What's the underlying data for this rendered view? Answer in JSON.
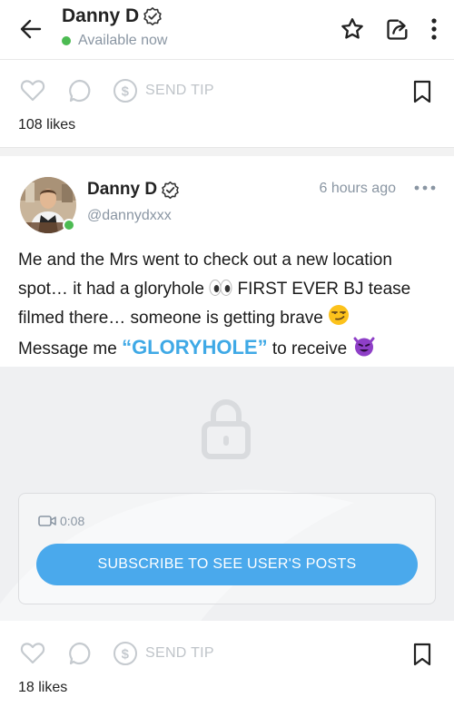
{
  "header": {
    "name": "Danny D",
    "status": "Available now"
  },
  "top_post": {
    "send_tip": "SEND TIP",
    "likes": "108 likes"
  },
  "post": {
    "author": "Danny D",
    "handle": "@dannydxxx",
    "time": "6 hours ago",
    "text_1": "Me and the Mrs went to check out a new location spot… it had a gloryhole",
    "text_2": "FIRST EVER BJ tease filmed there… someone is getting brave",
    "text_3": "Message me",
    "keyword": "“GLORYHOLE”",
    "text_4": "to receive",
    "video_duration": "0:08",
    "subscribe_label": "SUBSCRIBE TO SEE USER'S POSTS",
    "send_tip": "SEND TIP",
    "likes": "18 likes"
  },
  "colors": {
    "accent": "#4aa9ec",
    "online": "#4cbb52",
    "muted": "#8a96a3",
    "action_icons": "#c5cacf"
  },
  "icons": [
    "back-arrow-icon",
    "verified-icon",
    "star-icon",
    "share-icon",
    "more-vertical-icon",
    "heart-icon",
    "comment-icon",
    "dollar-icon",
    "bookmark-icon",
    "lock-icon",
    "video-camera-icon",
    "more-horizontal-icon"
  ]
}
